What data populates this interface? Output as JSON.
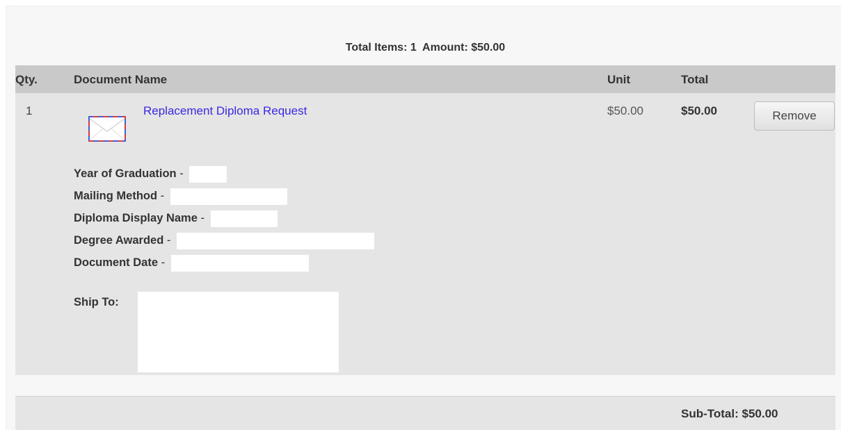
{
  "summary": {
    "total_items_label": "Total Items: 1",
    "amount_label": "Amount: $50.00"
  },
  "table": {
    "headers": {
      "qty": "Qty.",
      "name": "Document Name",
      "unit": "Unit",
      "total": "Total"
    }
  },
  "item": {
    "qty": "1",
    "icon": "envelope-icon",
    "name": "Replacement Diploma Request",
    "unit": "$50.00",
    "total": "$50.00",
    "remove_label": "Remove",
    "details": [
      {
        "label": "Year of Graduation",
        "separator": " - "
      },
      {
        "label": "Mailing Method",
        "separator": " - "
      },
      {
        "label": "Diploma Display Name",
        "separator": " - "
      },
      {
        "label": "Degree Awarded",
        "separator": " - "
      },
      {
        "label": "Document Date",
        "separator": " - "
      }
    ],
    "ship_to_label": "Ship To:"
  },
  "footer": {
    "subtotal_label": "Sub-Total: $50.00"
  },
  "colors": {
    "link": "#3b27e0",
    "header_bg": "#c9c9c9",
    "row_bg": "#e5e5e5",
    "panel_bg": "#f7f7f7"
  }
}
